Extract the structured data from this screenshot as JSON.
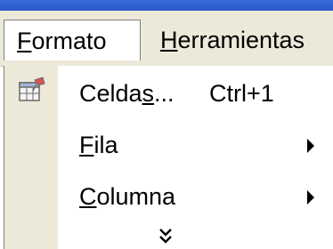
{
  "menubar": {
    "menus": [
      {
        "pre": "",
        "accel": "F",
        "post": "ormato"
      },
      {
        "pre": "",
        "accel": "H",
        "post": "erramientas"
      }
    ]
  },
  "dropdown": {
    "items": [
      {
        "pre": "Celda",
        "accel": "s",
        "post": "...",
        "shortcut": "Ctrl+1",
        "icon": "format-cells-icon",
        "has_submenu": false
      },
      {
        "pre": "",
        "accel": "F",
        "post": "ila",
        "shortcut": "",
        "icon": "",
        "has_submenu": true
      },
      {
        "pre": "",
        "accel": "C",
        "post": "olumna",
        "shortcut": "",
        "icon": "",
        "has_submenu": true
      }
    ],
    "expand_icon": "double-chevron-down-icon"
  },
  "colors": {
    "titlebar": "#2a5ac8",
    "menubar": "#ece9d8",
    "menu_bg": "#ffffff",
    "icon_column": "#ece9d8"
  }
}
